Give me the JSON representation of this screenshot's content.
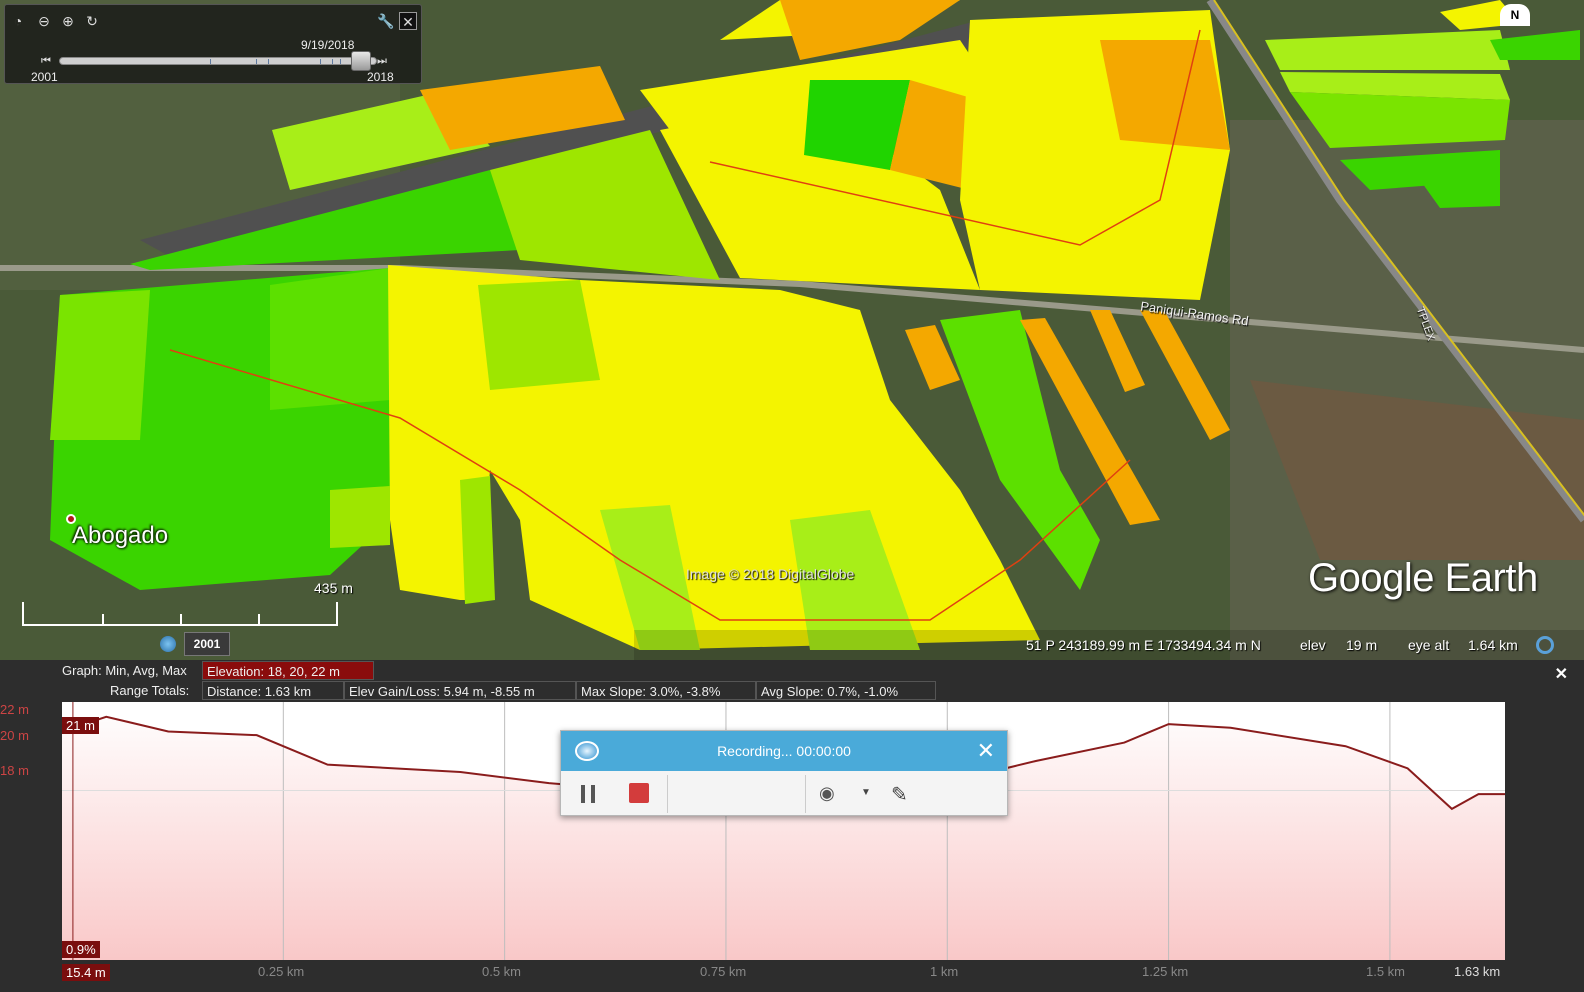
{
  "map": {
    "place_label": "Abogado",
    "road_label": "Paniqui-Ramos Rd",
    "highway_label": "TPLEX",
    "scale_label": "435 m",
    "copyright": "Image © 2018 DigitalGlobe",
    "brand": "Google Earth",
    "compass": "N",
    "historical_year": "2001"
  },
  "time_slider": {
    "current_date": "9/19/2018",
    "start_year": "2001",
    "end_year": "2018",
    "progress": 0.95
  },
  "status": {
    "coords": "51 P 243189.99 m E 1733494.34 m N",
    "elev_label": "elev",
    "elev_value": "19 m",
    "eye_alt_label": "eye alt",
    "eye_alt_value": "1.64 km"
  },
  "profile": {
    "graph_label": "Graph: Min, Avg, Max",
    "elevation": "Elevation: 18, 20, 22 m",
    "range_label": "Range Totals:",
    "distance": "Distance: 1.63 km",
    "elev_gain": "Elev Gain/Loss: 5.94 m, -8.55 m",
    "max_slope": "Max Slope: 3.0%, -3.8%",
    "avg_slope": "Avg Slope: 0.7%, -1.0%",
    "y_labels": [
      "22 m",
      "20 m",
      "18 m"
    ],
    "x_labels": [
      "0.25 km",
      "0.5 km",
      "0.75 km",
      "1 km",
      "1.25 km",
      "1.5 km",
      "1.63 km"
    ],
    "cursor_elev": "21 m",
    "cursor_slope": "0.9%",
    "cursor_dist": "15.4 m",
    "close": "✕"
  },
  "recorder": {
    "title": "Recording... 00:00:00",
    "close": "✕"
  },
  "colors": {
    "profile_line": "#8a1c1c",
    "profile_fill_top": "#ffffff",
    "profile_fill_bottom": "#f9c8c8",
    "field_yellow": "#f4f400",
    "field_green": "#3cd800",
    "field_lime": "#9ee800",
    "field_orange": "#f4a000"
  },
  "chart_data": {
    "type": "area",
    "xlabel": "",
    "ylabel": "",
    "ylim": [
      15.4,
      22.4
    ],
    "xlim": [
      0,
      1.63
    ],
    "x": [
      0,
      0.05,
      0.12,
      0.22,
      0.3,
      0.45,
      0.55,
      0.65,
      0.72,
      0.76,
      0.8,
      0.9,
      0.98,
      1.1,
      1.2,
      1.25,
      1.32,
      1.45,
      1.52,
      1.57,
      1.6,
      1.63
    ],
    "values": [
      21.6,
      22.0,
      21.6,
      21.5,
      20.7,
      20.5,
      20.2,
      20.0,
      20.5,
      21.0,
      20.3,
      19.9,
      20.1,
      20.8,
      21.3,
      21.8,
      21.7,
      21.2,
      20.6,
      19.5,
      19.9,
      19.9
    ],
    "series": [
      {
        "values": [
          21.6,
          22.0,
          21.6,
          21.5,
          20.7,
          20.5,
          20.2,
          20.0,
          20.5,
          21.0,
          20.3,
          19.9,
          20.1,
          20.8,
          21.3,
          21.8,
          21.7,
          21.2,
          20.6,
          19.5,
          19.9,
          19.9
        ]
      }
    ],
    "grid": true
  }
}
